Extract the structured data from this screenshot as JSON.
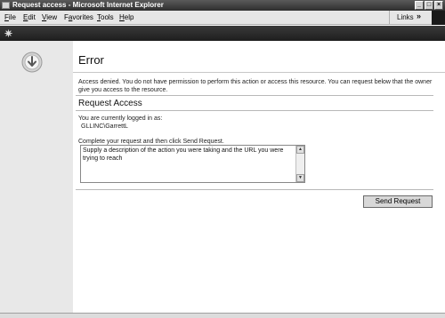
{
  "window": {
    "title": "Request access - Microsoft Internet Explorer",
    "minimize_glyph": "_",
    "maximize_glyph": "□",
    "close_glyph": "×"
  },
  "menu": {
    "items": [
      {
        "u": "F",
        "rest": "ile"
      },
      {
        "u": "E",
        "rest": "dit"
      },
      {
        "u": "V",
        "rest": "iew"
      },
      {
        "pre": "F",
        "u": "a",
        "rest": "vorites"
      },
      {
        "u": "T",
        "rest": "ools"
      },
      {
        "u": "H",
        "rest": "elp"
      }
    ],
    "links_label": "Links",
    "links_chevron": "»"
  },
  "page": {
    "title": "Error",
    "message": "Access denied. You do not have permission to perform this action or access this resource. You can request below that the owner give you access to the resource.",
    "section_title": "Request Access",
    "logged_in_label": "You are currently logged in as:",
    "logged_in_user": "GLLINC\\GarrettL",
    "complete_label": "Complete your request and then click Send Request.",
    "textarea_value": "Supply a description of the action you were taking and the URL you were trying to reach",
    "send_button": "Send Request"
  },
  "icons": {
    "page_icon": "download-arrow-icon",
    "strip_icon": "sharepoint-logo-icon"
  }
}
